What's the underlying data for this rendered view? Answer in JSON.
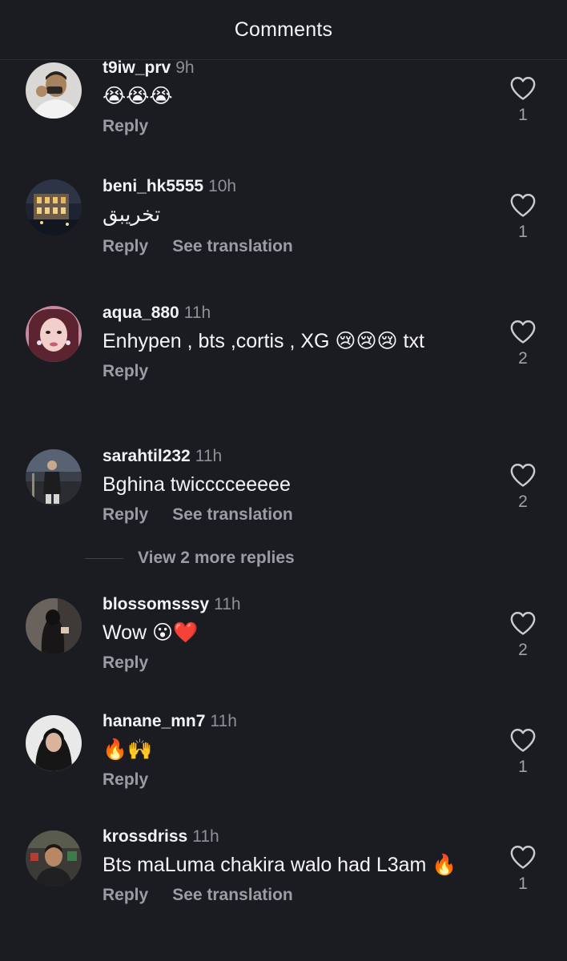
{
  "header": {
    "title": "Comments"
  },
  "comments": [
    {
      "username": "t9iw_prv",
      "time": "9h",
      "text": "😭😭😭",
      "reply": "Reply",
      "likes": "1"
    },
    {
      "username": "beni_hk5555",
      "time": "10h",
      "text": "تخريبق",
      "reply": "Reply",
      "translate": "See translation",
      "likes": "1"
    },
    {
      "username": "aqua_880",
      "time": "11h",
      "text": "Enhypen , bts ,cortis , XG 😢😢😢 txt",
      "reply": "Reply",
      "likes": "2"
    },
    {
      "username": "sarahtil232",
      "time": "11h",
      "text": "Bghina twicccceeeee",
      "reply": "Reply",
      "translate": "See translation",
      "likes": "2"
    },
    {
      "username": "blossomsssy",
      "time": "11h",
      "text": "Wow 😮❤️",
      "reply": "Reply",
      "likes": "2"
    },
    {
      "username": "hanane_mn7",
      "time": "11h",
      "text": "🔥🙌",
      "reply": "Reply",
      "likes": "1"
    },
    {
      "username": "krossdriss",
      "time": "11h",
      "text": "Bts maLuma chakira walo had L3am 🔥",
      "reply": "Reply",
      "translate": "See translation",
      "likes": "1"
    }
  ],
  "view_more": {
    "label": "View 2 more replies"
  },
  "icons": {
    "like": "heart-outline-icon"
  },
  "colors": {
    "background": "#1b1c21",
    "muted": "#9a9da4"
  }
}
